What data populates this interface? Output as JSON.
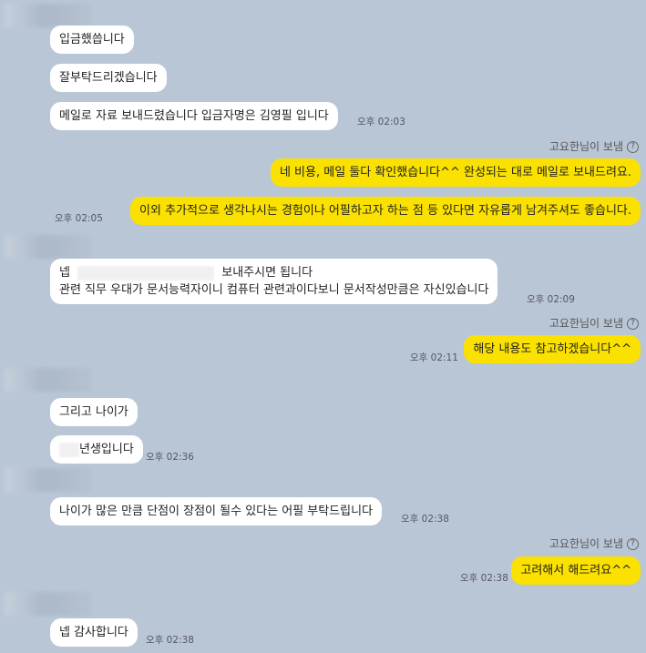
{
  "messages": [
    {
      "text": "입금했씁니다"
    },
    {
      "text": "잘부탁드리겠습니다"
    },
    {
      "text": "메일로 자료 보내드렸습니다 입금자명은 김영필 입니다",
      "time": "오후 02:03"
    },
    {
      "sender": "고요한님이 보냄",
      "text": "네 비용, 메일 둘다 확인했습니다^^ 완성되는 대로 메일로 보내드려요."
    },
    {
      "text": "이외 추가적으로 생각나시는 경험이나 어필하고자 하는 점 등 있다면 자유롭게 남겨주셔도 좋습니다.",
      "time": "오후 02:05"
    },
    {
      "text_prefix": "넵",
      "text_suffix": "보내주시면 됩니다",
      "text_line2": "관련 직무 우대가 문서능력자이니 컴퓨터 관련과이다보니 문서작성만큼은 자신있습니다",
      "time": "오후 02:09"
    },
    {
      "sender": "고요한님이 보냄",
      "text": "해당 내용도 참고하겠습니다^^",
      "time": "오후 02:11"
    },
    {
      "text": "그리고 나이가"
    },
    {
      "text": "년생입니다",
      "time": "오후 02:36"
    },
    {
      "text": "나이가 많은 만큼 단점이 장점이 될수 있다는 어필 부탁드립니다",
      "time": "오후 02:38"
    },
    {
      "sender": "고요한님이 보냄",
      "text": "고려해서 해드려요^^",
      "time": "오후 02:38"
    },
    {
      "text": "넵 감사합니다",
      "time": "오후 02:38"
    }
  ],
  "icons": {
    "help": "?"
  },
  "colors": {
    "background": "#b9c6d6",
    "incoming": "#ffffff",
    "outgoing": "#fae100"
  }
}
